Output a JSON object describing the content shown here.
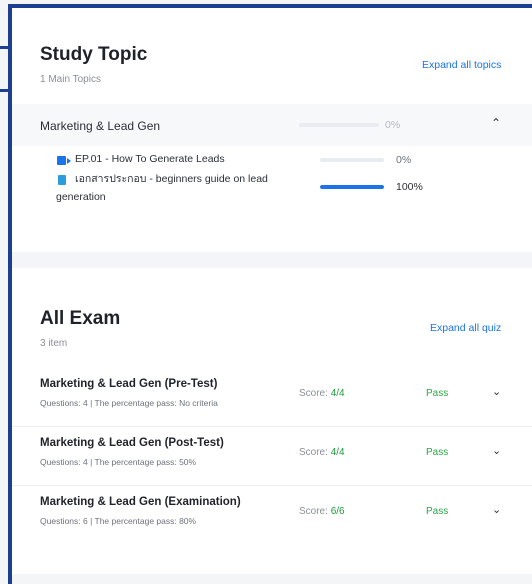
{
  "study_topic": {
    "title": "Study Topic",
    "subtitle": "1 Main Topics",
    "expand_label": "Expand all topics",
    "topic": {
      "name": "Marketing & Lead Gen",
      "progress_label": "0%",
      "progress": 0,
      "lessons": [
        {
          "icon": "video-icon",
          "title": "EP.01 - How To Generate Leads",
          "progress_label": "0%",
          "progress": 0
        },
        {
          "icon": "document-icon",
          "title_line1": "เอกสารประกอบ - beginners guide on lead",
          "title_line2": "generation",
          "progress_label": "100%",
          "progress": 1
        }
      ]
    }
  },
  "all_exam": {
    "title": "All Exam",
    "subtitle": "3 item",
    "expand_label": "Expand all quiz",
    "score_label": "Score:",
    "exams": [
      {
        "name": "Marketing & Lead Gen (Pre-Test)",
        "meta": "Questions: 4  |  The percentage pass: No criteria",
        "score": "4/4",
        "status": "Pass"
      },
      {
        "name": "Marketing & Lead Gen (Post-Test)",
        "meta": "Questions: 4  |  The percentage pass: 50%",
        "score": "4/4",
        "status": "Pass"
      },
      {
        "name": "Marketing & Lead Gen (Examination)",
        "meta": "Questions: 6  |  The percentage pass: 80%",
        "score": "6/6",
        "status": "Pass"
      }
    ]
  },
  "colors": {
    "accent": "#1a73e8",
    "pass": "#2aa745",
    "frame": "#1d3f8f"
  }
}
